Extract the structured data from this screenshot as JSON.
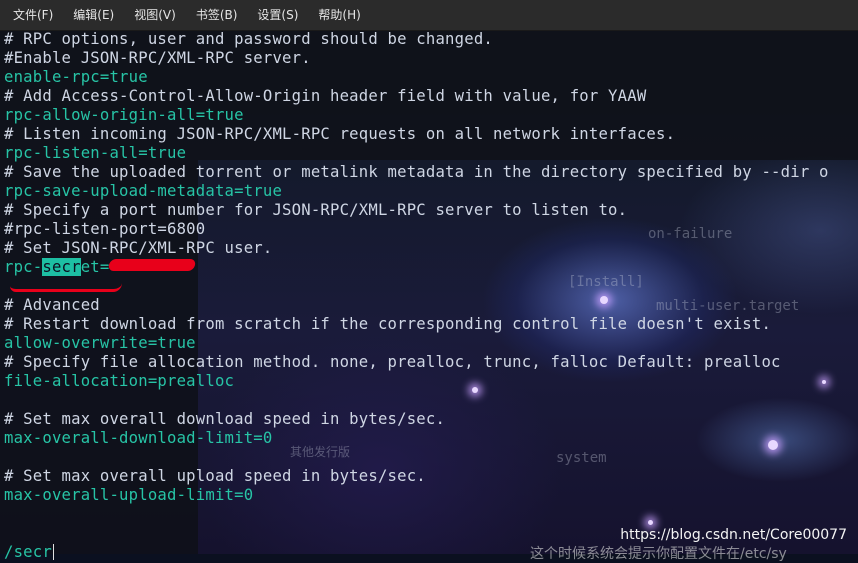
{
  "menu": [
    "文件(F)",
    "编辑(E)",
    "视图(V)",
    "书签(B)",
    "设置(S)",
    "帮助(H)"
  ],
  "lines": [
    {
      "t": "# RPC options, user and password should be changed.",
      "k": "comment"
    },
    {
      "t": "#Enable JSON-RPC/XML-RPC server.",
      "k": "comment"
    },
    {
      "t": "enable-rpc=true",
      "k": "setting"
    },
    {
      "t": "# Add Access-Control-Allow-Origin header field with value, for YAAW",
      "k": "comment"
    },
    {
      "t": "rpc-allow-origin-all=true",
      "k": "setting"
    },
    {
      "t": "# Listen incoming JSON-RPC/XML-RPC requests on all network interfaces.",
      "k": "comment"
    },
    {
      "t": "rpc-listen-all=true",
      "k": "setting"
    },
    {
      "t": "# Save the uploaded torrent or metalink metadata in the directory specified by --dir o",
      "k": "comment"
    },
    {
      "t": "rpc-save-upload-metadata=true",
      "k": "setting"
    },
    {
      "t": "# Specify a port number for JSON-RPC/XML-RPC server to listen to.",
      "k": "comment"
    },
    {
      "t": "#rpc-listen-port=6800",
      "k": "comment"
    },
    {
      "t": "# Set JSON-RPC/XML-RPC user.",
      "k": "comment"
    },
    {
      "t": "",
      "k": "secret"
    },
    {
      "t": "",
      "k": "blank"
    },
    {
      "t": "# Advanced",
      "k": "comment"
    },
    {
      "t": "# Restart download from scratch if the corresponding control file doesn't exist.",
      "k": "comment"
    },
    {
      "t": "allow-overwrite=true",
      "k": "setting"
    },
    {
      "t": "# Specify file allocation method. none, prealloc, trunc, falloc Default: prealloc",
      "k": "comment"
    },
    {
      "t": "file-allocation=prealloc",
      "k": "setting"
    },
    {
      "t": "",
      "k": "blank"
    },
    {
      "t": "# Set max overall download speed in bytes/sec.",
      "k": "comment"
    },
    {
      "t": "max-overall-download-limit=0",
      "k": "setting"
    },
    {
      "t": "",
      "k": "blank"
    },
    {
      "t": "# Set max overall upload speed in bytes/sec.",
      "k": "comment"
    },
    {
      "t": "max-overall-upload-limit=0",
      "k": "setting"
    },
    {
      "t": "",
      "k": "blank"
    },
    {
      "t": "",
      "k": "blank"
    }
  ],
  "secret_line": {
    "prefix": "rpc-",
    "match": "secr",
    "suffix": "et="
  },
  "search_prompt": "/secr",
  "watermark": "https://blog.csdn.net/Core00077",
  "bg_texts": [
    "on-failure",
    "multi-user.target",
    "[Install]",
    "其他发行版",
    "system",
    "这个时候系统会提示你配置文件在/etc/sy"
  ],
  "colors": {
    "comment": "#cfd6e4",
    "setting": "#27c4a6",
    "highlight": "#1dbfa3",
    "redaction": "#e8001a",
    "menubar": "#2b2b2b"
  }
}
